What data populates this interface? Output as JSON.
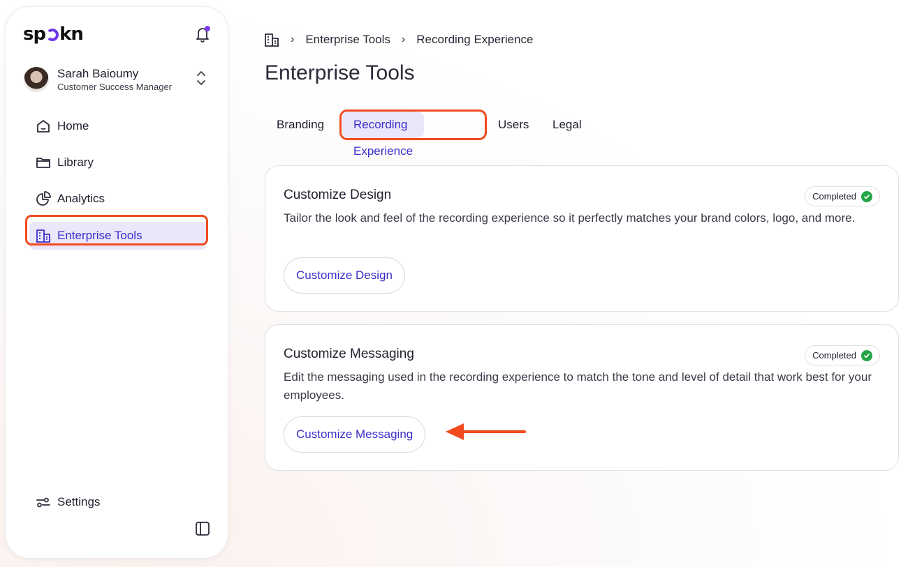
{
  "sidebar": {
    "logo": {
      "before": "sp",
      "after": "kn",
      "accent": "#6b36e8"
    },
    "user": {
      "name": "Sarah Baioumy",
      "role": "Customer Success Manager"
    },
    "items": [
      {
        "label": "Home",
        "icon": "home-icon"
      },
      {
        "label": "Library",
        "icon": "folder-icon"
      },
      {
        "label": "Analytics",
        "icon": "pie-chart-icon"
      },
      {
        "label": "Enterprise Tools",
        "icon": "building-icon",
        "active": true
      }
    ],
    "settings_label": "Settings"
  },
  "breadcrumb": [
    "Enterprise Tools",
    "Recording Experience"
  ],
  "page_title": "Enterprise Tools",
  "tabs": [
    {
      "label": "Branding"
    },
    {
      "label": "Recording Experience",
      "active": true
    },
    {
      "label": "Users"
    },
    {
      "label": "Legal"
    }
  ],
  "cards": [
    {
      "title": "Customize Design",
      "status": "Completed",
      "description": "Tailor the look and feel of the recording experience so it perfectly matches your brand colors, logo, and more.",
      "button": "Customize Design"
    },
    {
      "title": "Customize Messaging",
      "status": "Completed",
      "description": "Edit the messaging used in the recording experience to match the tone and level of detail that work best for your employees.",
      "button": "Customize Messaging"
    }
  ],
  "colors": {
    "accent": "#3a2fc9",
    "active_bg": "#ebe7fb",
    "highlight": "#f04a1e",
    "success": "#22a447"
  }
}
